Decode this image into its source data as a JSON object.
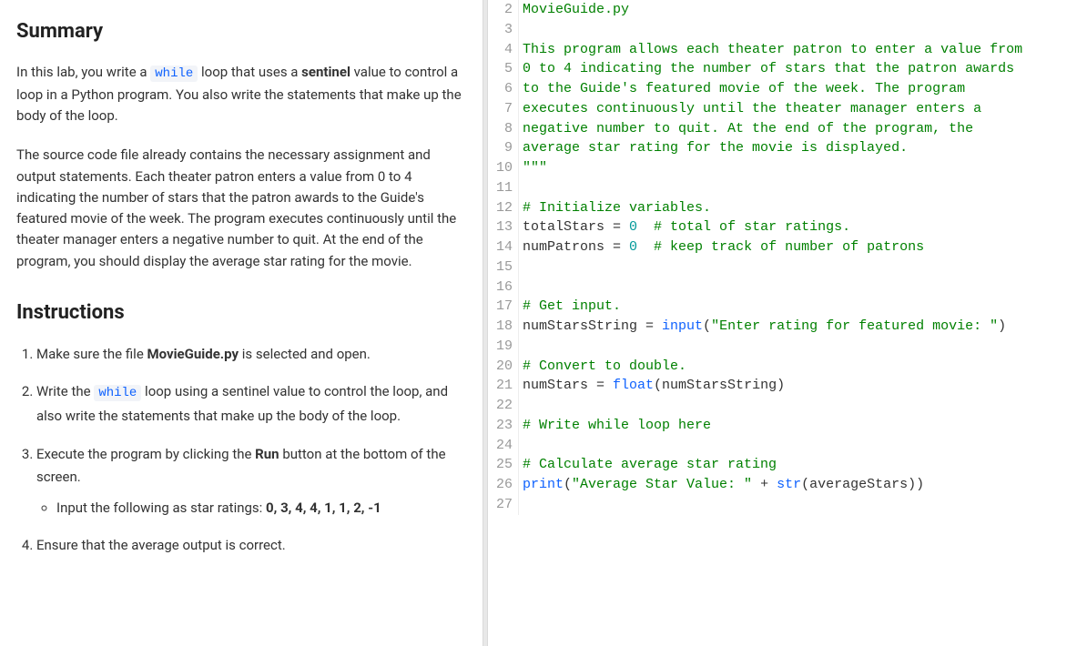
{
  "summary": {
    "heading": "Summary",
    "p1_seg1": "In this lab, you write a ",
    "p1_code": "while",
    "p1_seg2": " loop that uses a ",
    "p1_bold": "sentinel",
    "p1_seg3": " value to control a loop in a Python program. You also write the statements that make up the body of the loop.",
    "p2": "The source code file already contains the necessary assignment and output statements. Each theater patron enters a value from 0 to 4 indicating the number of stars that the patron awards to the Guide's featured movie of the week. The program executes continuously until the theater manager enters a negative number to quit. At the end of the program, you should display the average star rating for the movie."
  },
  "instructions": {
    "heading": "Instructions",
    "step1_pre": "Make sure the file ",
    "step1_bold": "MovieGuide.py",
    "step1_post": " is selected and open.",
    "step2_pre": "Write the ",
    "step2_code": "while",
    "step2_post": " loop using a sentinel value to control the loop, and also write the statements that make up the body of the loop.",
    "step3_pre": "Execute the program by clicking the ",
    "step3_bold": "Run",
    "step3_post": " button at the bottom of the screen.",
    "step3_sub_pre": "Input the following as star ratings: ",
    "step3_sub_bold": "0, 3, 4, 4, 1, 1, 2, -1",
    "step4": "Ensure that the average output is correct."
  },
  "code": {
    "l2": "MovieGuide.py",
    "l3": "",
    "l4": "This program allows each theater patron to enter a value from",
    "l5": "0 to 4 indicating the number of stars that the patron awards",
    "l6": "to the Guide's featured movie of the week. The program",
    "l7": "executes continuously until the theater manager enters a",
    "l8": "negative number to quit. At the end of the program, the",
    "l9": "average star rating for the movie is displayed.",
    "l10": "\"\"\"",
    "l11": "",
    "l12_c": "# Initialize variables.",
    "l13_a": "totalStars = ",
    "l13_n": "0",
    "l13_c": "  # total of star ratings.",
    "l14_a": "numPatrons = ",
    "l14_n": "0",
    "l14_c": "  # keep track of number of patrons",
    "l15": "",
    "l16": "",
    "l17_c": "# Get input.",
    "l18_a": "numStarsString = ",
    "l18_f": "input",
    "l18_p1": "(",
    "l18_s": "\"Enter rating for featured movie: \"",
    "l18_p2": ")",
    "l19": "",
    "l20_c": "# Convert to double.",
    "l21_a": "numStars = ",
    "l21_f": "float",
    "l21_p1": "(numStarsString)",
    "l22": "",
    "l23_c": "# Write while loop here",
    "l24": "",
    "l25_c": "# Calculate average star rating",
    "l26_f": "print",
    "l26_p1": "(",
    "l26_s": "\"Average Star Value: \"",
    "l26_mid": " + ",
    "l26_f2": "str",
    "l26_p2": "(averageStars))",
    "l27": ""
  },
  "line_numbers": [
    "2",
    "3",
    "4",
    "5",
    "6",
    "7",
    "8",
    "9",
    "10",
    "11",
    "12",
    "13",
    "14",
    "15",
    "16",
    "17",
    "18",
    "19",
    "20",
    "21",
    "22",
    "23",
    "24",
    "25",
    "26",
    "27"
  ]
}
